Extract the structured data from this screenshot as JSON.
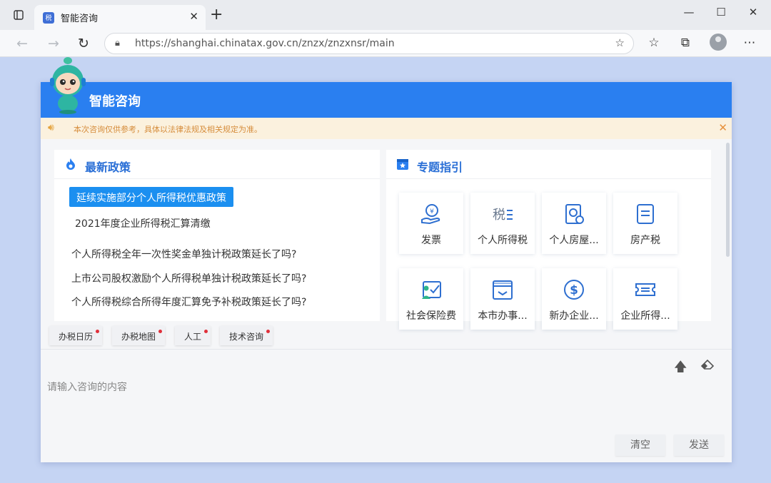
{
  "browser": {
    "tab_title": "智能咨询",
    "tab_favicon_text": "税",
    "url": "https://shanghai.chinatax.gov.cn/znzx/znzxnsr/main"
  },
  "header": {
    "title": "智能咨询"
  },
  "notice": {
    "text": "本次咨询仅供参考，具体以法律法规及相关规定为准。"
  },
  "policies": {
    "title": "最新政策",
    "items": [
      "延续实施部分个人所得税优惠政策",
      "2021年度企业所得税汇算清缴"
    ],
    "questions": [
      "个人所得税全年一次性奖金单独计税政策延长了吗?",
      "上市公司股权激励个人所得税单独计税政策延长了吗?",
      "个人所得税综合所得年度汇算免予补税政策延长了吗?"
    ]
  },
  "topics": {
    "title": "专题指引",
    "tiles": [
      {
        "label": "发票",
        "icon": "invoice-hand-icon"
      },
      {
        "label": "个人所得税",
        "icon": "tax-char-icon"
      },
      {
        "label": "个人房屋...",
        "icon": "house-money-icon"
      },
      {
        "label": "房产税",
        "icon": "document-icon"
      },
      {
        "label": "社会保险费",
        "icon": "social-insurance-icon"
      },
      {
        "label": "本市办事...",
        "icon": "calendar-icon"
      },
      {
        "label": "新办企业...",
        "icon": "dollar-circle-icon"
      },
      {
        "label": "企业所得...",
        "icon": "ticket-icon"
      }
    ]
  },
  "quick_chips": [
    "办税日历",
    "办税地图",
    "人工",
    "技术咨询"
  ],
  "input": {
    "placeholder": "请输入咨询的内容"
  },
  "buttons": {
    "clear": "清空",
    "send": "发送"
  },
  "colors": {
    "brand_blue": "#2a7ff0",
    "highlight_blue": "#1b8ff0",
    "notice_text": "#d68d3c",
    "chip_dot": "#e0303a"
  }
}
